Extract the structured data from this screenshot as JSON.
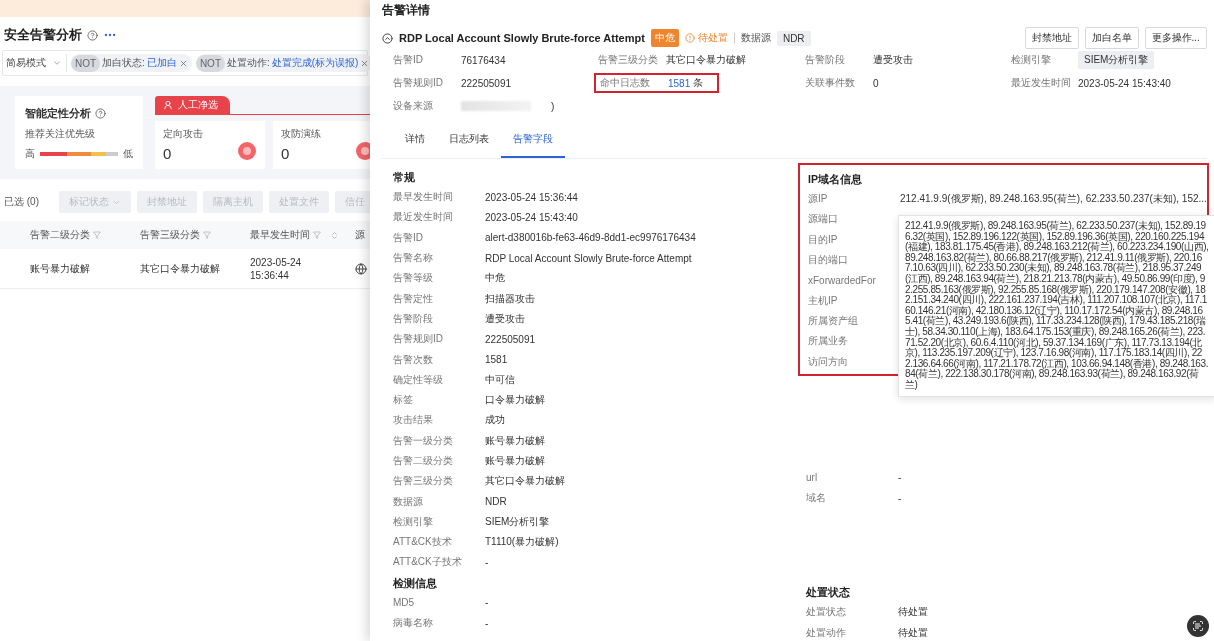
{
  "page": {
    "title": "安全告警分析",
    "mode_select": "简易模式",
    "filters": [
      {
        "not": "NOT",
        "field": "加白状态:",
        "value": "已加白"
      },
      {
        "not": "NOT",
        "field": "处置动作:",
        "value": "处置完成(标为误报)"
      }
    ],
    "analysis": {
      "title": "智能定性分析",
      "priority_label": "推荐关注优先级",
      "high": "高",
      "low": "低"
    },
    "manual_tab": "人工净选",
    "stat_cards": [
      {
        "label": "定向攻击",
        "value": "0"
      },
      {
        "label": "攻防演练",
        "value": "0"
      }
    ],
    "selected_count": "已选 (0)",
    "bulk_actions": [
      {
        "label": "标记状态",
        "dropdown": true,
        "disabled": true
      },
      {
        "label": "封禁地址",
        "dropdown": false,
        "disabled": true
      },
      {
        "label": "隔离主机",
        "dropdown": false,
        "disabled": true
      },
      {
        "label": "处置文件",
        "dropdown": false,
        "disabled": true
      },
      {
        "label": "信任",
        "dropdown": false,
        "disabled": true
      }
    ],
    "table": {
      "columns": [
        {
          "label": "告警二级分类",
          "filter": true,
          "sort": false
        },
        {
          "label": "告警三级分类",
          "filter": true,
          "sort": false
        },
        {
          "label": "最早发生时间",
          "filter": true,
          "sort": true
        },
        {
          "label": "源"
        }
      ],
      "rows": [
        [
          "账号暴力破解",
          "其它口令暴力破解",
          "2023-05-24 15:36:44"
        ]
      ]
    }
  },
  "drawer": {
    "title": "告警详情",
    "alert": {
      "name": "RDP Local Account Slowly Brute-force Attempt",
      "severity": "中危",
      "status": "待处置",
      "source_label": "数据源",
      "source": "NDR"
    },
    "actions": [
      "封禁地址",
      "加白名单",
      "更多操作..."
    ],
    "summary": [
      {
        "label": "告警ID",
        "value": "76176434",
        "kind": "text",
        "highlighted": false
      },
      {
        "label": "告警三级分类",
        "value": "其它口令暴力破解",
        "kind": "text",
        "highlighted": false
      },
      {
        "label": "告警阶段",
        "value": "遭受攻击",
        "kind": "text",
        "highlighted": false
      },
      {
        "label": "检测引擎",
        "value": "SIEM分析引擎",
        "kind": "tag",
        "highlighted": false
      },
      {
        "label": "告警规则ID",
        "value": "222505091",
        "kind": "text",
        "highlighted": false
      },
      {
        "label": "命中日志数",
        "value": "1581",
        "unit": "条",
        "kind": "link",
        "highlighted": true
      },
      {
        "label": "关联事件数",
        "value": "0",
        "kind": "text",
        "highlighted": false
      },
      {
        "label": "最近发生时间",
        "value": "2023-05-24 15:43:40",
        "kind": "text",
        "highlighted": false
      },
      {
        "label": "设备来源",
        "value": ")",
        "kind": "redacted",
        "highlighted": false
      }
    ],
    "tabs": [
      {
        "label": "详情",
        "selected": false
      },
      {
        "label": "日志列表",
        "selected": false
      },
      {
        "label": "告警字段",
        "selected": true
      }
    ],
    "left_sections": [
      {
        "title": "常规",
        "highlighted": false,
        "fields": [
          {
            "label": "最早发生时间",
            "value": "2023-05-24 15:36:44"
          },
          {
            "label": "最近发生时间",
            "value": "2023-05-24 15:43:40"
          },
          {
            "label": "告警ID",
            "value": "alert-d380016b-fe63-46d9-8dd1-ec9976176434"
          },
          {
            "label": "告警名称",
            "value": "RDP Local Account Slowly Brute-force Attempt"
          },
          {
            "label": "告警等级",
            "value": "中危"
          },
          {
            "label": "告警定性",
            "value": "扫描器攻击"
          },
          {
            "label": "告警阶段",
            "value": "遭受攻击"
          },
          {
            "label": "告警规则ID",
            "value": "222505091"
          },
          {
            "label": "告警次数",
            "value": "1581"
          },
          {
            "label": "确定性等级",
            "value": "中可信"
          },
          {
            "label": "标签",
            "value": "口令暴力破解"
          },
          {
            "label": "攻击结果",
            "value": "成功"
          },
          {
            "label": "告警一级分类",
            "value": "账号暴力破解"
          },
          {
            "label": "告警二级分类",
            "value": "账号暴力破解"
          },
          {
            "label": "告警三级分类",
            "value": "其它口令暴力破解"
          },
          {
            "label": "数据源",
            "value": "NDR"
          },
          {
            "label": "检测引擎",
            "value": "SIEM分析引擎"
          },
          {
            "label": "ATT&CK技术",
            "value": "T1110(暴力破解)"
          },
          {
            "label": "ATT&CK子技术",
            "value": "-"
          }
        ]
      },
      {
        "title": "检测信息",
        "highlighted": false,
        "fields": [
          {
            "label": "MD5",
            "value": "-"
          },
          {
            "label": "病毒名称",
            "value": "-"
          }
        ]
      }
    ],
    "right_sections": [
      {
        "title": "IP域名信息",
        "highlighted": true,
        "fields": [
          {
            "label": "源IP",
            "value": "212.41.9.9(俄罗斯), 89.248.163.95(荷兰), 62.233.50.237(未知), 152..."
          },
          {
            "label": "源端口"
          },
          {
            "label": "目的IP"
          },
          {
            "label": "目的端口"
          },
          {
            "label": "xForwardedFor"
          },
          {
            "label": "主机IP"
          },
          {
            "label": "所属资产组"
          },
          {
            "label": "所属业务"
          },
          {
            "label": "访问方向"
          }
        ],
        "tooltip": "212.41.9.9(俄罗斯), 89.248.163.95(荷兰), 62.233.50.237(未知), 152.89.196.32(英国), 152.89.196.122(英国), 152.89.196.36(英国), 220.160.225.194(福建), 183.81.175.45(香港), 89.248.163.212(荷兰), 60.223.234.190(山西), 89.248.163.82(荷兰), 80.66.88.217(俄罗斯), 212.41.9.11(俄罗斯), 220.167.10.63(四川), 62.233.50.230(未知), 89.248.163.78(荷兰), 218.95.37.249(江西), 89.248.163.94(荷兰), 218.21.213.78(内蒙古), 49.50.86.99(印度), 92.255.85.163(俄罗斯), 92.255.85.168(俄罗斯), 220.179.147.208(安徽), 182.151.34.240(四川), 222.161.237.194(吉林), 111.207.108.107(北京), 117.160.146.21(河南), 42.180.136.12(辽宁), 110.17.172.54(内蒙古), 89.248.165.41(荷兰), 43.249.193.6(陕西), 117.33.234.128(陕西), 179.43.185.218(瑞士), 58.34.30.110(上海), 183.64.175.153(重庆), 89.248.165.26(荷兰), 223.71.52.20(北京), 60.6.4.110(河北), 59.37.134.169(广东), 117.73.13.194(北京), 113.235.197.209(辽宁), 123.7.16.98(河南), 117.175.183.14(四川), 222.136.64.66(河南), 117.21.178.72(江西), 103.66.94.148(香港), 89.248.163.84(荷兰), 222.138.30.178(河南), 89.248.163.93(荷兰), 89.248.163.92(荷兰)"
      },
      {
        "highlighted": false,
        "fields": [
          {
            "label": "url",
            "value": "-"
          },
          {
            "label": "域名",
            "value": "-"
          }
        ]
      },
      {
        "title": "处置状态",
        "highlighted": false,
        "fields": [
          {
            "label": "处置状态",
            "value": "待处置"
          },
          {
            "label": "处置动作",
            "value": "待处置"
          }
        ]
      }
    ]
  }
}
